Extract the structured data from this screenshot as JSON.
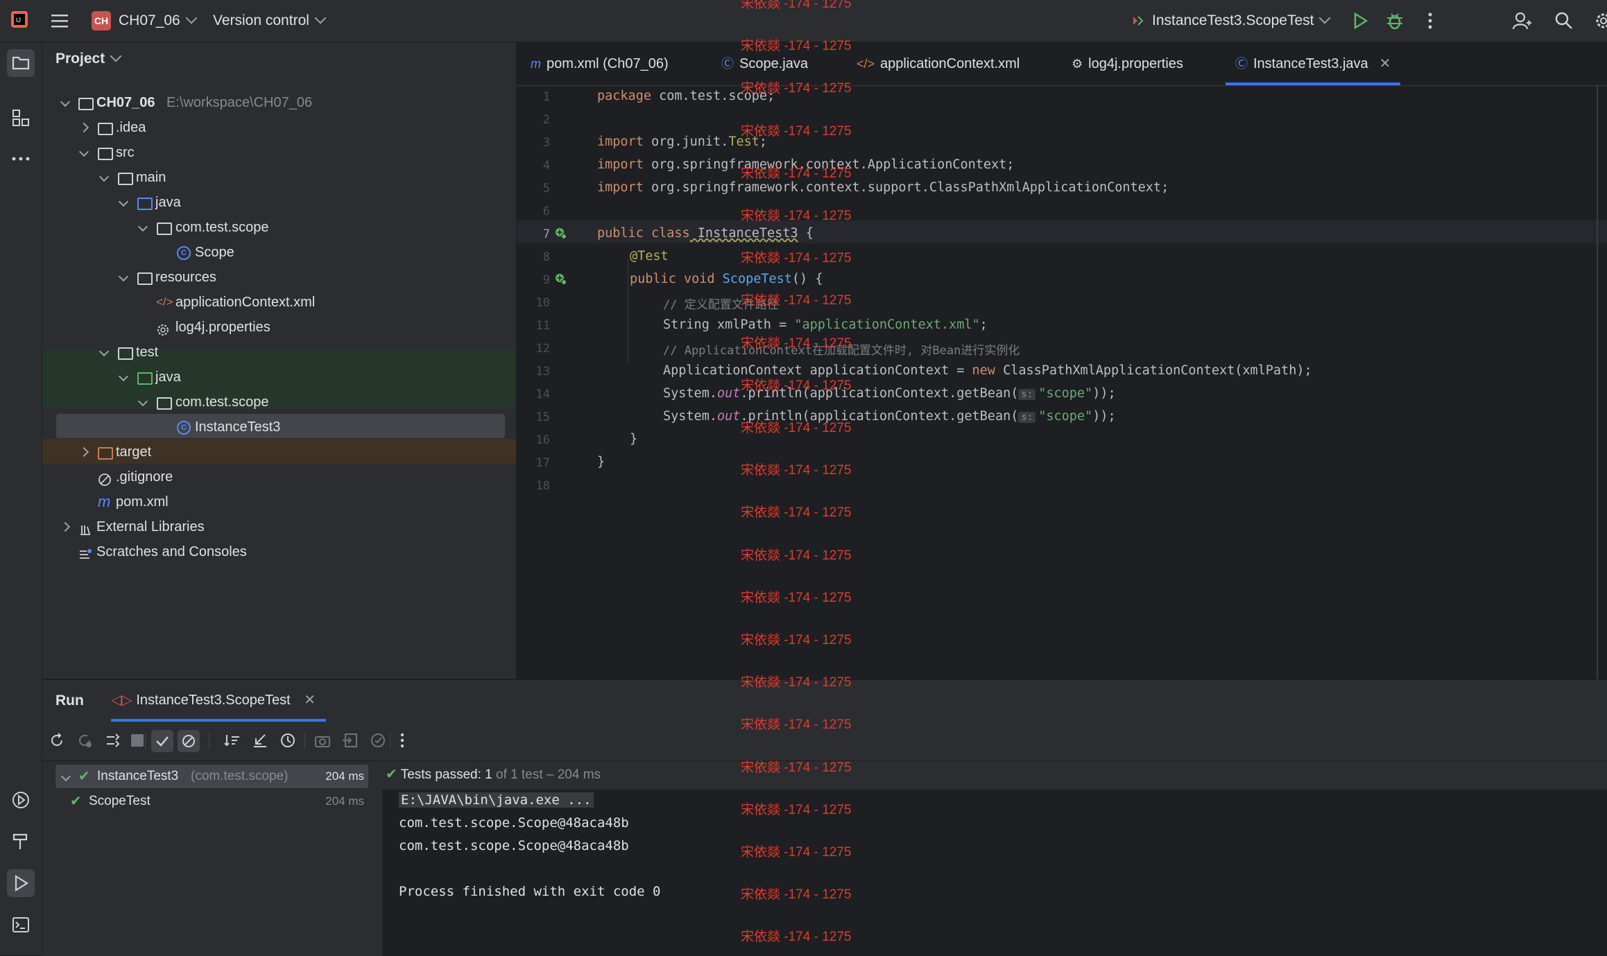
{
  "titlebar": {
    "badge": "CH",
    "project_name": "CH07_06",
    "version_control": "Version control",
    "run_config": "InstanceTest3.ScopeTest"
  },
  "project_panel": {
    "title": "Project",
    "tree": [
      {
        "label": "CH07_06",
        "path": "E:\\workspace\\CH07_06"
      },
      {
        "label": ".idea"
      },
      {
        "label": "src"
      },
      {
        "label": "main"
      },
      {
        "label": "java"
      },
      {
        "label": "com.test.scope"
      },
      {
        "label": "Scope"
      },
      {
        "label": "resources"
      },
      {
        "label": "applicationContext.xml"
      },
      {
        "label": "log4j.properties"
      },
      {
        "label": "test"
      },
      {
        "label": "java"
      },
      {
        "label": "com.test.scope"
      },
      {
        "label": "InstanceTest3"
      },
      {
        "label": "target"
      },
      {
        "label": ".gitignore"
      },
      {
        "label": "pom.xml"
      },
      {
        "label": "External Libraries"
      },
      {
        "label": "Scratches and Consoles"
      }
    ]
  },
  "tabs": [
    "pom.xml (Ch07_06)",
    "Scope.java",
    "applicationContext.xml",
    "log4j.properties",
    "InstanceTest3.java"
  ],
  "editor": {
    "line_numbers": [
      "1",
      "2",
      "3",
      "4",
      "5",
      "6",
      "7",
      "8",
      "9",
      "10",
      "11",
      "12",
      "13",
      "14",
      "15",
      "16",
      "17",
      "18"
    ],
    "lines": {
      "l1a": "package",
      "l1b": " com.test.scope;",
      "l3a": "import",
      "l3b": " org.junit.",
      "l3c": "Test",
      "l3d": ";",
      "l4a": "import",
      "l4b": " org.springframework.context.ApplicationContext;",
      "l5a": "import",
      "l5b": " org.springframework.context.support.ClassPathXmlApplicationContext;",
      "l7a": "public class",
      "l7b": " InstanceTest3",
      "l7c": " {",
      "l8": "@Test",
      "l9a": "public void",
      "l9b": " ScopeTest",
      "l9c": "() {",
      "l10": "// 定义配置文件路径",
      "l11a": "String xmlPath = ",
      "l11b": "\"applicationContext.xml\"",
      "l11c": ";",
      "l12": "// ApplicationContext在加载配置文件时, 对Bean进行实例化",
      "l13a": "ApplicationContext applicationContext = ",
      "l13b": "new",
      "l13c": " ClassPathXmlApplicationContext(xmlPath);",
      "l14a": "System.",
      "l14b": "out",
      "l14c": ".println(applicationContext.getBean(",
      "l14h": "s:",
      "l14d": "\"scope\"",
      "l14e": "));",
      "l15a": "System.",
      "l15b": "out",
      "l15c": ".println(applicationContext.getBean(",
      "l15h": "s:",
      "l15d": "\"scope\"",
      "l15e": "));",
      "l16": "}",
      "l17": "}"
    }
  },
  "run_panel": {
    "title": "Run",
    "tab": "InstanceTest3.ScopeTest",
    "tests": [
      {
        "name": "InstanceTest3",
        "pkg": "(com.test.scope)",
        "time": "204 ms"
      },
      {
        "name": "ScopeTest",
        "time": "204 ms"
      }
    ],
    "status_passed": "Tests passed: 1",
    "status_rest": " of 1 test – 204 ms",
    "console": [
      "E:\\JAVA\\bin\\java.exe ...",
      "com.test.scope.Scope@48aca48b",
      "com.test.scope.Scope@48aca48b",
      "",
      "Process finished with exit code 0"
    ]
  },
  "watermark": "宋依燚 -174 - 1275",
  "colors": {
    "accent": "#3574f0",
    "pass": "#5fb865",
    "watermark": "#e03b30"
  }
}
